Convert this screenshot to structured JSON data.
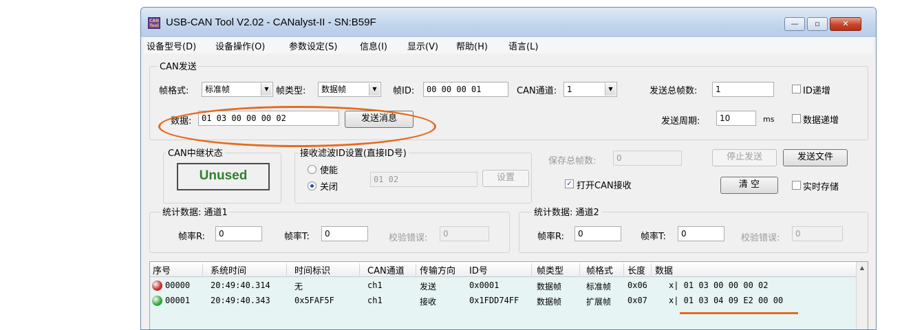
{
  "window": {
    "title": "USB-CAN Tool V2.02 - CANalyst-II - SN:B59F",
    "icon_text": "CAN Tool",
    "minimize_glyph": "—",
    "maximize_glyph": "▫",
    "close_glyph": "✕"
  },
  "menu": [
    "设备型号(D)",
    "设备操作(O)",
    "参数设定(S)",
    "信息(I)",
    "显示(V)",
    "帮助(H)",
    "语言(L)"
  ],
  "can_send": {
    "group_title": "CAN发送",
    "frame_format_label": "帧格式:",
    "frame_format_value": "标准帧",
    "frame_type_label": "帧类型:",
    "frame_type_value": "数据帧",
    "frame_id_label": "帧ID:",
    "frame_id_value": "00 00 00 01",
    "can_channel_label": "CAN通道:",
    "can_channel_value": "1",
    "total_frames_label": "发送总帧数:",
    "total_frames_value": "1",
    "id_increment_label": "ID递增",
    "data_label": "数据:",
    "data_value": "01 03 00 00 00 02",
    "send_button": "发送消息",
    "period_label": "发送周期:",
    "period_value": "10",
    "period_unit": "ms",
    "data_increment_label": "数据递增"
  },
  "relay": {
    "group_title": "CAN中继状态",
    "status": "Unused"
  },
  "filter": {
    "group_title": "接收滤波ID设置(直接ID号)",
    "enable_label": "使能",
    "disable_label": "关闭",
    "selected": "关闭",
    "ids_value": "01 02",
    "set_button": "设置"
  },
  "save": {
    "total_label": "保存总帧数:",
    "total_value": "0",
    "open_receive_label": "打开CAN接收",
    "open_receive_checked": true,
    "stop_send_button": "停止发送",
    "send_file_button": "发送文件",
    "clear_button": "清 空",
    "realtime_save_label": "实时存储"
  },
  "stats1": {
    "group_title": "统计数据: 通道1",
    "rate_r_label": "帧率R:",
    "rate_r_value": "0",
    "rate_t_label": "帧率T:",
    "rate_t_value": "0",
    "checksum_label": "校验错误:",
    "checksum_value": "0"
  },
  "stats2": {
    "group_title": "统计数据: 通道2",
    "rate_r_label": "帧率R:",
    "rate_r_value": "0",
    "rate_t_label": "帧率T:",
    "rate_t_value": "0",
    "checksum_label": "校验错误:",
    "checksum_value": "0"
  },
  "table": {
    "headers": [
      "序号",
      "系统时间",
      "时间标识",
      "CAN通道",
      "传输方向",
      "ID号",
      "帧类型",
      "帧格式",
      "长度",
      "数据"
    ],
    "rows": [
      {
        "status_color": "#c62a22",
        "seq": "00000",
        "sys_time": "20:49:40.314",
        "timestamp": "无",
        "channel": "ch1",
        "direction": "发送",
        "id": "0x0001",
        "frame_type": "数据帧",
        "frame_format": "标准帧",
        "length": "0x06",
        "data": "x| 01 03 00 00 00 02"
      },
      {
        "status_color": "#2aa636",
        "seq": "00001",
        "sys_time": "20:49:40.343",
        "timestamp": "0x5FAF5F",
        "channel": "ch1",
        "direction": "接收",
        "id": "0x1FDD74FF",
        "frame_type": "数据帧",
        "frame_format": "扩展帧",
        "length": "0x07",
        "data": "x| 01 03 04 09 E2 00 00"
      }
    ]
  },
  "colors": {
    "annotation": "#e76a1f",
    "unused_text": "#2f7f2f"
  }
}
